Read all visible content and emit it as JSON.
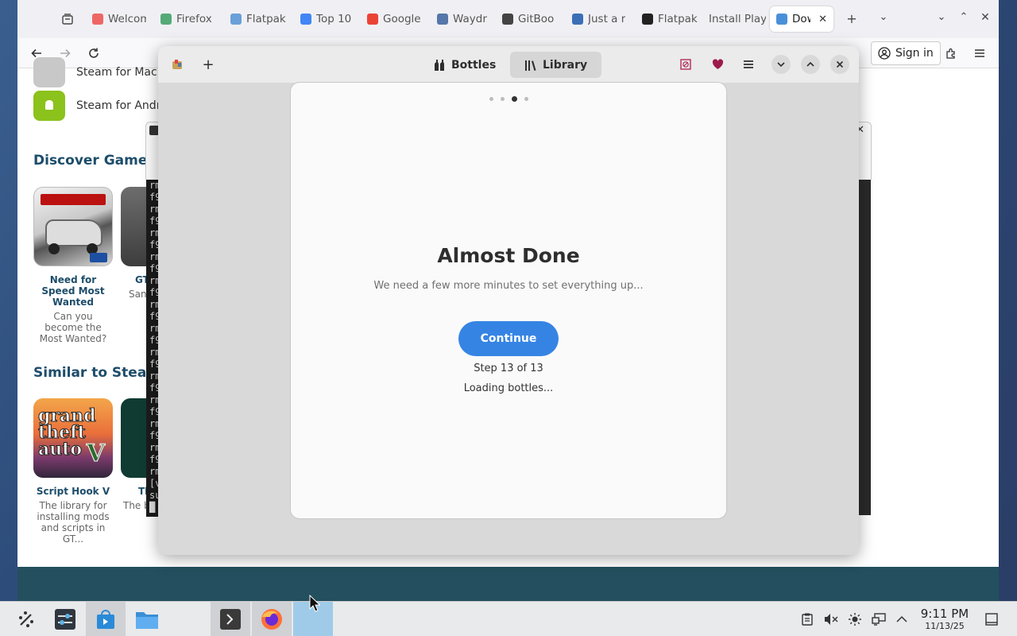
{
  "firefox": {
    "tabs": [
      {
        "label": "Welcom",
        "color": "#e66"
      },
      {
        "label": "Firefox",
        "color": "#5a7"
      },
      {
        "label": "Flatpak",
        "color": "#6a9fd8"
      },
      {
        "label": "Top 10",
        "color": "#4285f4"
      },
      {
        "label": "Google",
        "color": "#ea4335"
      },
      {
        "label": "Waydr",
        "color": "#5577aa"
      },
      {
        "label": "GitBoo",
        "color": "#444"
      },
      {
        "label": "Just a r",
        "color": "#3b6fb6"
      },
      {
        "label": "Flatpak",
        "color": "#222"
      },
      {
        "label": "Install Play",
        "color": ""
      },
      {
        "label": "Dow",
        "color": "#4a90d9"
      }
    ],
    "signin_label": "Sign in"
  },
  "page": {
    "download_rows": [
      "Steam for Mac",
      "Steam for Android"
    ],
    "discover_heading": "Discover Games a",
    "similar_heading": "Similar to Steam",
    "discover_cards": [
      {
        "name": "Need for Speed Most Wanted",
        "desc": "Can you become the Most Wanted?"
      },
      {
        "name": "GTA San Andreas",
        "desc": "San Andreas back"
      }
    ],
    "similar_cards": [
      {
        "name": "Script Hook V",
        "desc": "The library for installing mods and scripts in GT..."
      },
      {
        "name": "Th",
        "desc": "The b for Mi"
      }
    ]
  },
  "terminal": {
    "lines": [
      "rm",
      "f9",
      "rm",
      "f9",
      "rm",
      "f9",
      "rm",
      "f9",
      "rm",
      "f9",
      "rm",
      "f9",
      "rm",
      "f9",
      "rm",
      "f9",
      "rm",
      "f9",
      "rm",
      "f9",
      "rm",
      "f9",
      "rm",
      "f9",
      "rm",
      "[v",
      "su",
      "█"
    ]
  },
  "bottles": {
    "view_bottles": "Bottles",
    "view_library": "Library",
    "dialog": {
      "title": "Almost Done",
      "subtitle": "We need a few more minutes to set everything up...",
      "continue_label": "Continue",
      "step_text": "Step 13 of 13",
      "loading_text": "Loading bottles..."
    },
    "pager_total": 4,
    "pager_current": 3
  },
  "taskbar": {
    "clock_time": "9:11 PM",
    "clock_date": "11/13/25"
  },
  "colors": {
    "accent": "#3584e4",
    "heading": "#1d4d6a",
    "footer": "#234f5e"
  }
}
